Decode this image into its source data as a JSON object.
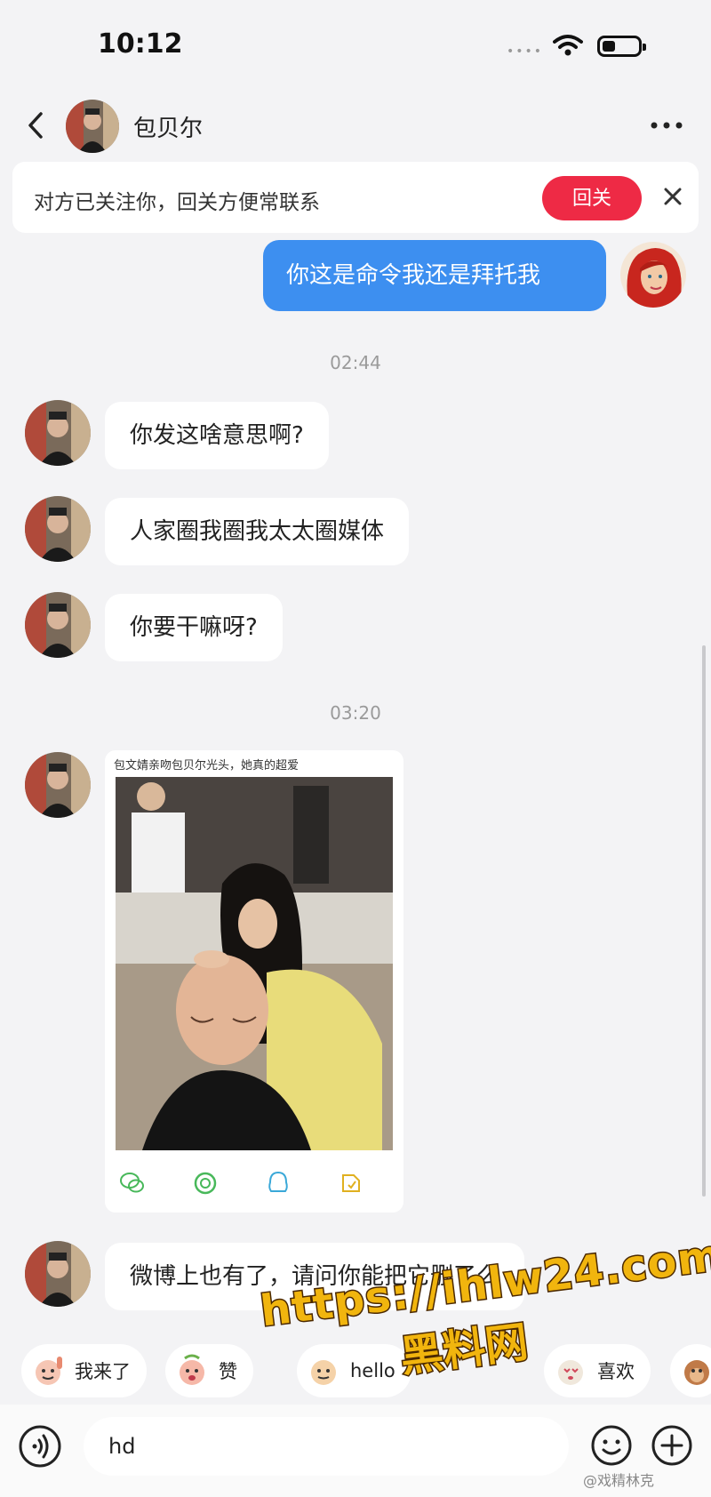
{
  "status_bar": {
    "time": "10:12",
    "signal_dots": "••••"
  },
  "header": {
    "contact_name": "包贝尔"
  },
  "banner": {
    "text": "对方已关注你，回关方便常联系",
    "follow_label": "回关"
  },
  "messages": {
    "sent_1": "你这是命令我还是拜托我",
    "time_1": "02:44",
    "recv_1": "你发这啥意思啊?",
    "recv_2": "人家圈我圈我太太圈媒体",
    "recv_3": "你要干嘛呀?",
    "time_2": "03:20",
    "image_caption": "包文婧亲吻包贝尔光头，她真的超爱",
    "recv_4": "微博上也有了，请问你能把它删了么"
  },
  "quick_replies": [
    {
      "label": "我来了"
    },
    {
      "label": "赞"
    },
    {
      "label": "hello"
    },
    {
      "label": "喜欢"
    }
  ],
  "input": {
    "value": "hd"
  },
  "watermark": {
    "url": "https://ihlw24.com",
    "name": "黑料网",
    "source": "@戏精林克"
  },
  "colors": {
    "sent_bubble": "#3d8ff0",
    "follow_button": "#ee2a45",
    "background": "#f3f3f5"
  }
}
